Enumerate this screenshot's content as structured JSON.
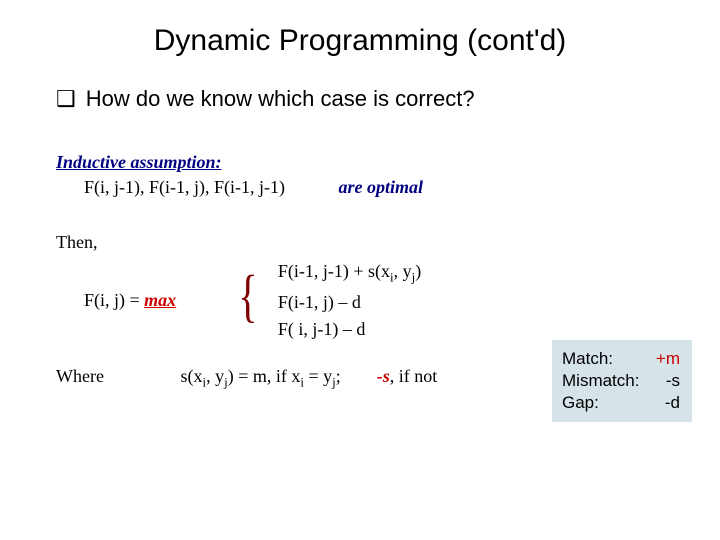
{
  "title": "Dynamic Programming (cont'd)",
  "question": {
    "bullet": "❑",
    "text": "How do we know which case is correct?"
  },
  "inductive": {
    "label": "Inductive assumption:",
    "lhs_plain": "F(i, j-1), F(i-1, j), F(i-1, j-1)",
    "rhs": "are optimal"
  },
  "then": "Then,",
  "max": {
    "lhs_pre": "F(i, j) = ",
    "lhs_max": "max",
    "case1_a": "F(i-1, j-1) + s(x",
    "case1_i": "i",
    "case1_b": ", y",
    "case1_j": "j",
    "case1_c": ")",
    "case2": "F(i-1,   j) – d",
    "case3": "F(  i, j-1) – d"
  },
  "where": {
    "label": "Where",
    "def_a": "s(x",
    "def_i": "i",
    "def_b": ", y",
    "def_j": "j",
    "def_c": ") = m, if x",
    "def_d": " = y",
    "def_e": ";",
    "neg": "-s",
    "tail": ", if not"
  },
  "legend": {
    "match_l": "Match:",
    "match_v": "+m",
    "mis_l": "Mismatch:",
    "mis_v": "-s",
    "gap_l": "Gap:",
    "gap_v": "-d"
  }
}
